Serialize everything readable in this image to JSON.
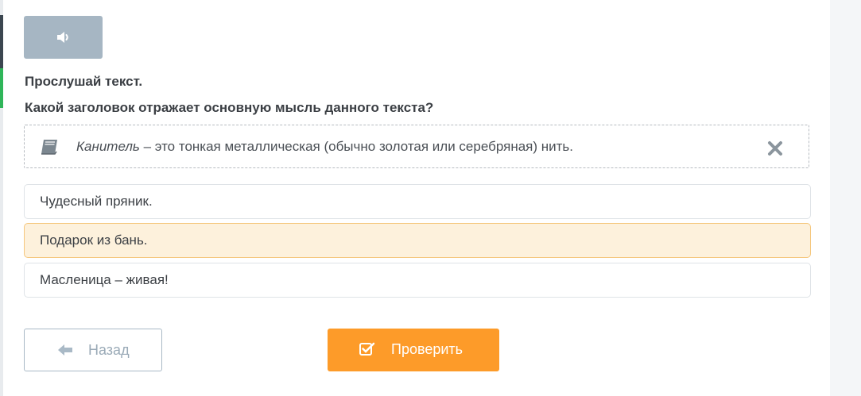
{
  "audio": {
    "icon": "speaker-icon",
    "color": "#a6b6c3"
  },
  "task": {
    "instruction": "Прослушай текст.",
    "question": "Какой заголовок отражает основную мысль данного текста?"
  },
  "hint": {
    "icon": "book-icon",
    "term": "Канитель",
    "definition": " – это тонкая металлическая (обычно золотая или серебряная) нить.",
    "close_icon": "close-icon"
  },
  "options": [
    {
      "label": "Чудесный пряник.",
      "selected": false
    },
    {
      "label": "Подарок из бань.",
      "selected": true
    },
    {
      "label": "Масленица – живая!",
      "selected": false
    }
  ],
  "nav": {
    "back_label": "Назад",
    "back_icon": "arrow-left-icon",
    "check_label": "Проверить",
    "check_icon": "checkbox-icon"
  },
  "colors": {
    "accent": "#fd9b29",
    "selected_bg": "#fdf1dc",
    "selected_border": "#f5c77e",
    "audio_button": "#a6b6c3"
  }
}
